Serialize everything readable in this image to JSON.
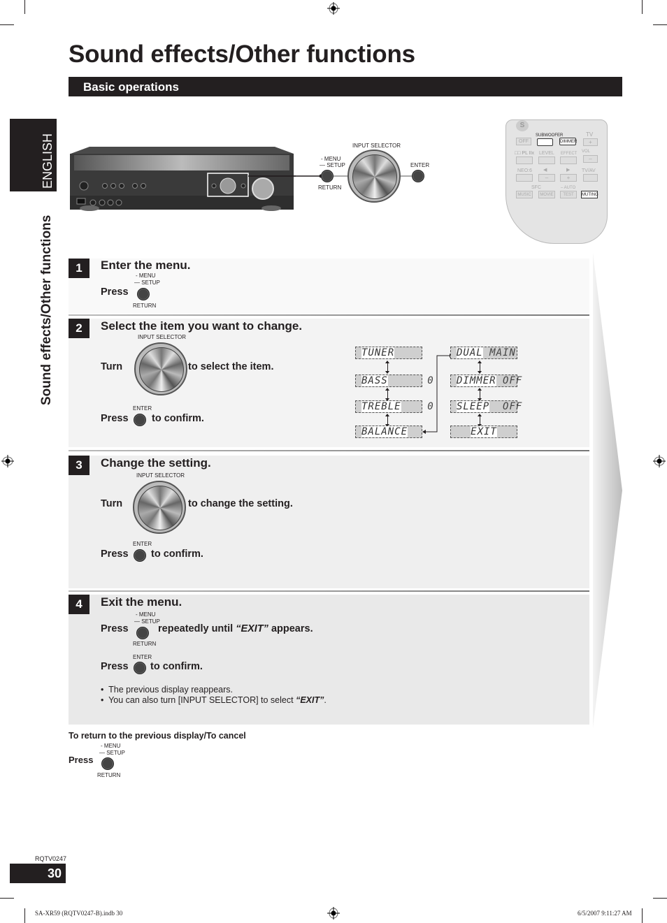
{
  "page": {
    "title": "Sound effects/Other functions",
    "section_heading": "Basic operations",
    "language_tab": "ENGLISH",
    "side_title": "Sound effects/Other functions",
    "doc_code": "RQTV0247",
    "page_number": "30",
    "slug_left": "SA-XR59 (RQTV0247-B).indb   30",
    "slug_right": "6/5/2007   9:11:27 AM"
  },
  "unit_diagram": {
    "input_selector_label": "INPUT SELECTOR",
    "menu_label": "- MENU",
    "setup_label": "— SETUP",
    "return_label": "RETURN",
    "enter_label": "ENTER"
  },
  "remote": {
    "s_label": "S",
    "subwoofer": "SUBWOOFER",
    "dimmer": "DIMMER",
    "tv": "TV",
    "off": "OFF",
    "pl2x": "□□ PL IIx",
    "level": "LEVEL",
    "effect": "EFFECT",
    "vol": "VOL",
    "plus": "+",
    "minus": "–",
    "neo6": "NEO:6",
    "left": "◀",
    "right": "▶",
    "tvav": "TV/AV",
    "sfc": "SFC",
    "auto": "– AUTO",
    "music": "MUSIC",
    "movie": "MOVIE",
    "test": "TEST",
    "muting": "MUTING"
  },
  "steps": [
    {
      "number": "1",
      "title": "Enter the menu.",
      "press": "Press",
      "btn_menu": "- MENU",
      "btn_setup": "— SETUP",
      "btn_return": "RETURN"
    },
    {
      "number": "2",
      "title": "Select the item you want to change.",
      "turn": "Turn",
      "knob_label": "INPUT SELECTOR",
      "turn_action": "to select the item.",
      "press": "Press",
      "enter_label": "ENTER",
      "press_action": "to confirm.",
      "display_items_left": [
        {
          "label": "TUNER",
          "value": ""
        },
        {
          "label": "BASS",
          "value": "0"
        },
        {
          "label": "TREBLE",
          "value": "0"
        },
        {
          "label": "BALANCE",
          "value": ""
        }
      ],
      "display_items_right": [
        {
          "label": "DUAL",
          "value": "MAIN"
        },
        {
          "label": "DIMMER",
          "value": "OFF"
        },
        {
          "label": "SLEEP",
          "value": "OFF"
        },
        {
          "label": "EXIT",
          "value": ""
        }
      ]
    },
    {
      "number": "3",
      "title": "Change the setting.",
      "turn": "Turn",
      "knob_label": "INPUT SELECTOR",
      "turn_action": "to change the setting.",
      "press": "Press",
      "enter_label": "ENTER",
      "press_action": "to confirm."
    },
    {
      "number": "4",
      "title": "Exit the menu.",
      "press": "Press",
      "btn_menu": "- MENU",
      "btn_setup": "— SETUP",
      "btn_return": "RETURN",
      "repeat_pre": "repeatedly until",
      "repeat_em": "“EXIT”",
      "repeat_post": "appears.",
      "press2": "Press",
      "enter_label": "ENTER",
      "press2_action": "to confirm.",
      "bullets": [
        {
          "text": "The previous display reappears.",
          "em": ""
        },
        {
          "text": "You can also turn [INPUT SELECTOR] to select ",
          "em": "“EXIT”",
          "tail": "."
        }
      ]
    }
  ],
  "cancel_note": {
    "heading": "To return to the previous display/To cancel",
    "press": "Press",
    "btn_menu": "- MENU",
    "btn_setup": "— SETUP",
    "btn_return": "RETURN"
  }
}
